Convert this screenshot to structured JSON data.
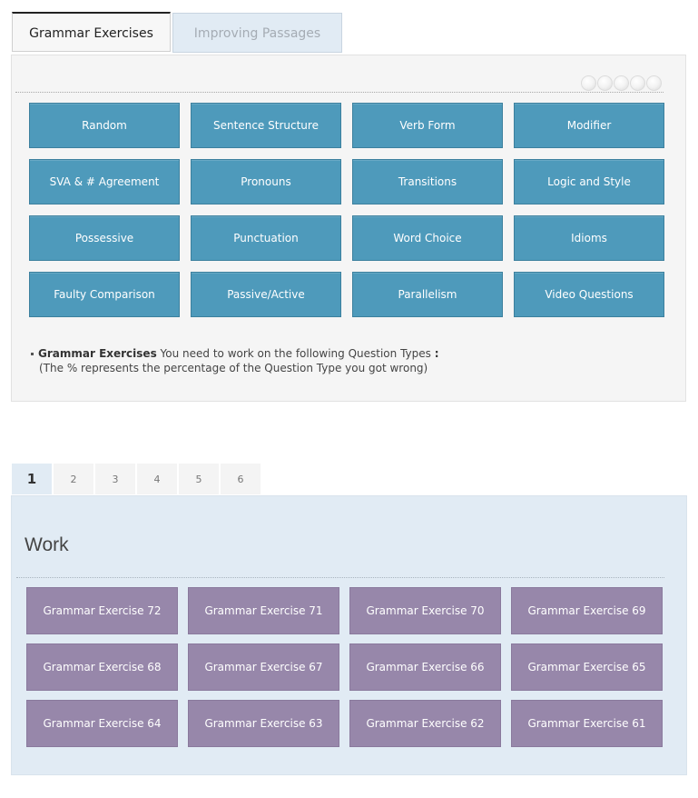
{
  "top_tabs": [
    {
      "label": "Grammar Exercises",
      "active": true
    },
    {
      "label": "Improving Passages",
      "active": false
    }
  ],
  "grammar_panel": {
    "pager_dots_count": 5,
    "topics": [
      "Random",
      "Sentence Structure",
      "Verb Form",
      "Modifier",
      "SVA & # Agreement",
      "Pronouns",
      "Transitions",
      "Logic and Style",
      "Possessive",
      "Punctuation",
      "Word Choice",
      "Idioms",
      "Faulty Comparison",
      "Passive/Active",
      "Parallelism",
      "Video Questions"
    ],
    "note": {
      "bold": "Grammar Exercises",
      "text": " You need to work on the following Question Types ",
      "colon": ":",
      "line2": "(The % represents the percentage of the Question Type you got wrong)"
    }
  },
  "page_tabs": {
    "pages": [
      "1",
      "2",
      "3",
      "4",
      "5",
      "6"
    ],
    "active": "1"
  },
  "work_panel": {
    "title": "Work",
    "exercises": [
      "Grammar Exercise 72",
      "Grammar Exercise 71",
      "Grammar Exercise 70",
      "Grammar Exercise 69",
      "Grammar Exercise 68",
      "Grammar Exercise 67",
      "Grammar Exercise 66",
      "Grammar Exercise 65",
      "Grammar Exercise 64",
      "Grammar Exercise 63",
      "Grammar Exercise 62",
      "Grammar Exercise 61"
    ]
  },
  "colors": {
    "topic_button": "#4e9abb",
    "exercise_button": "#9787aa",
    "work_panel_bg": "#e1ebf4",
    "grammar_panel_bg": "#f5f5f5"
  }
}
